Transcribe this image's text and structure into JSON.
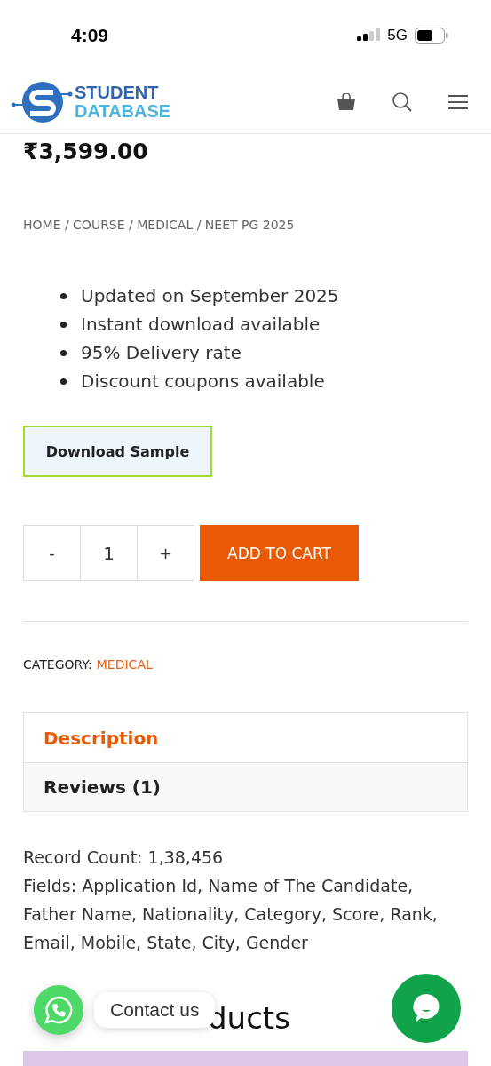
{
  "status_bar": {
    "time": "4:09",
    "network": "5G"
  },
  "header": {
    "logo_top": "STUDENT",
    "logo_bottom": "DATABASE"
  },
  "price": "₹3,599.00",
  "breadcrumb": "HOME / COURSE / MEDICAL / NEET PG 2025",
  "features": [
    "Updated on September 2025",
    "Instant download available",
    "95% Delivery rate",
    "Discount coupons available"
  ],
  "sample_button": "Download Sample",
  "quantity": {
    "minus": "-",
    "value": "1",
    "plus": "+"
  },
  "add_to_cart": "ADD TO CART",
  "category": {
    "label": "CATEGORY:",
    "value": "MEDICAL"
  },
  "tabs": [
    {
      "label": "Description",
      "selected": true
    },
    {
      "label": "Reviews (1)",
      "selected": false
    }
  ],
  "description": [
    "Record Count: 1,38,456",
    "Fields: Application Id, Name of The Candidate, Father Name, Nationality, Category, Score, Rank, Email, Mobile, State, City, Gender"
  ],
  "related_heading_visible": "ducts",
  "contact_label": "Contact us"
}
